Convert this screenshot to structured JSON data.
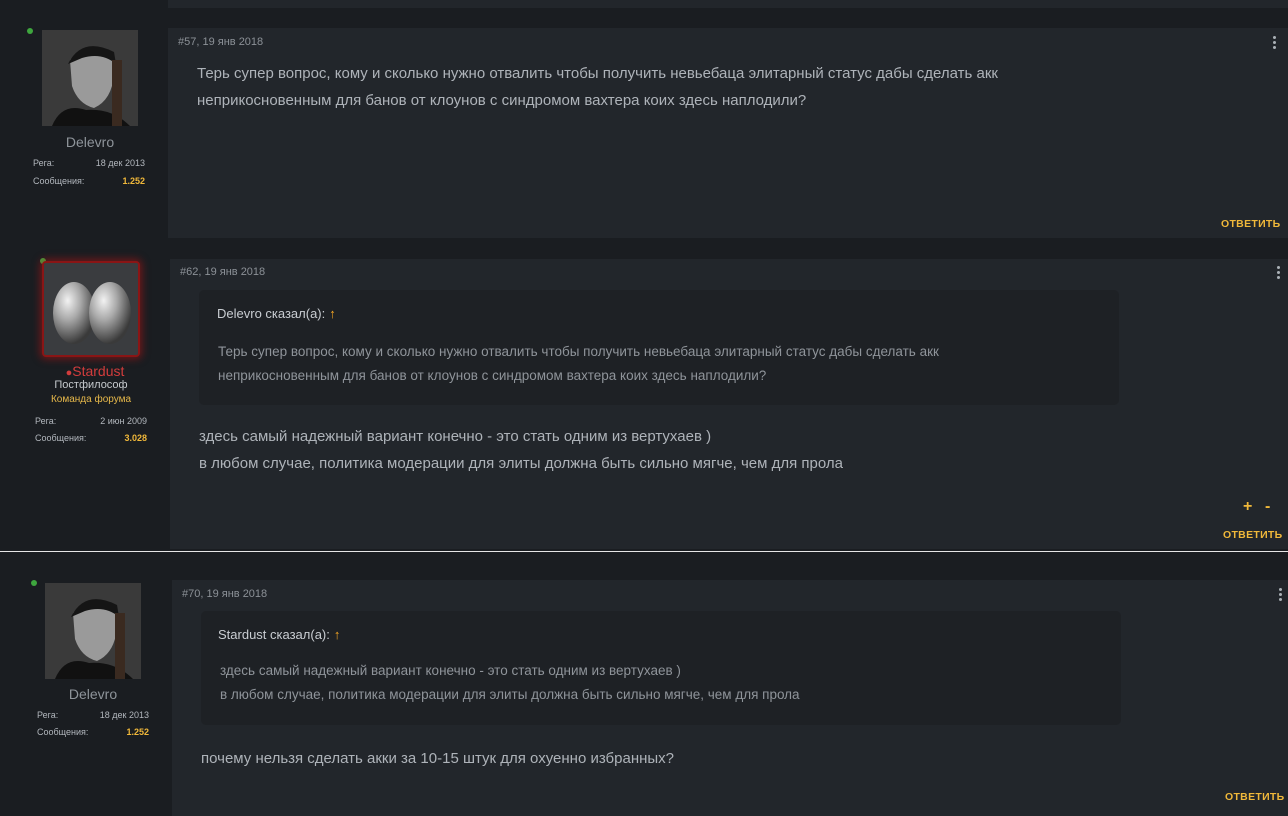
{
  "posts": [
    {
      "meta": "#57, 19 янв 2018",
      "username": "Delevro",
      "stats": [
        {
          "label": "Рега:",
          "value": "18 дек 2013"
        },
        {
          "label": "Сообщения:",
          "value": "1.252"
        }
      ],
      "message": [
        "Терь супер вопрос, кому и сколько нужно отвалить чтобы получить невьебаца элитарный статус дабы сделать акк",
        "неприкосновенным для банов от клоунов с синдромом вахтера коих здесь наплодили?"
      ],
      "reply_label": "ОТВЕТИТЬ"
    },
    {
      "meta": "#62, 19 янв 2018",
      "username": "Stardust",
      "user_title": "Постфилософ",
      "team_title": "Команда форума",
      "stats": [
        {
          "label": "Рега:",
          "value": "2 июн 2009"
        },
        {
          "label": "Сообщения:",
          "value": "3.028"
        }
      ],
      "quote": {
        "author": "Delevro сказал(а):",
        "arrow": "↑",
        "lines": [
          "Терь супер вопрос, кому и сколько нужно отвалить чтобы получить невьебаца элитарный статус дабы сделать акк",
          "неприкосновенным для банов от клоунов с синдромом вахтера коих здесь наплодили?"
        ]
      },
      "message": [
        "здесь самый надежный вариант конечно - это стать одним из вертухаев )",
        "в любом случае, политика модерации для элиты должна быть сильно мягче, чем для прола"
      ],
      "vote_plus": "+",
      "vote_minus": "-",
      "reply_label": "ОТВЕТИТЬ"
    },
    {
      "meta": "#70, 19 янв 2018",
      "username": "Delevro",
      "stats": [
        {
          "label": "Рега:",
          "value": "18 дек 2013"
        },
        {
          "label": "Сообщения:",
          "value": "1.252"
        }
      ],
      "quote": {
        "author": "Stardust сказал(а):",
        "arrow": "↑",
        "lines": [
          "здесь самый надежный вариант конечно - это стать одним из вертухаев )",
          "в любом случае, политика модерации для элиты должна быть сильно мягче, чем для прола"
        ]
      },
      "message": [
        "почему нельзя сделать акки за 10-15 штук для охуенно избранных?"
      ],
      "reply_label": "ОТВЕТИТЬ"
    }
  ],
  "colors": {
    "accent": "#f0b83a",
    "online": "#3ea63e",
    "staff_name": "#d23c3c",
    "post_bg": "#22262b",
    "quote_bg": "#1e2125"
  }
}
